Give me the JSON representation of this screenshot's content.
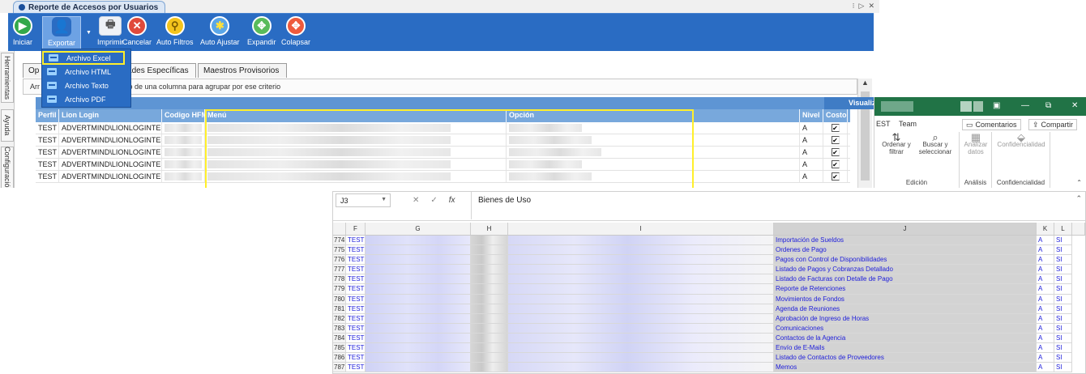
{
  "app": {
    "doc_tab_title": "Reporte de Accesos por Usuarios",
    "window_controls": [
      "⁝",
      "▷",
      "✕"
    ],
    "ribbon": [
      {
        "label": "Iniciar",
        "icon": "play-icon",
        "glyph": "▶"
      },
      {
        "label": "Exportar",
        "icon": "export-user-icon",
        "glyph": "👤"
      },
      {
        "label": "Imprimir",
        "icon": "printer-icon",
        "glyph": "🖶"
      },
      {
        "label": "Cancelar",
        "icon": "cancel-icon",
        "glyph": "✕"
      },
      {
        "label": "Auto Filtros",
        "icon": "filter-icon",
        "glyph": "⚲"
      },
      {
        "label": "Auto Ajustar",
        "icon": "wrench-icon",
        "glyph": "✱"
      },
      {
        "label": "Expandir",
        "icon": "expand-icon",
        "glyph": "✥"
      },
      {
        "label": "Colapsar",
        "icon": "collapse-icon",
        "glyph": "✥"
      }
    ],
    "side_tabs": [
      "Herramientas",
      "Ayuda",
      "Configuración"
    ],
    "export_menu": [
      "Archivo Excel",
      "Archivo HTML",
      "Archivo Texto",
      "Archivo PDF"
    ],
    "content_tabs": [
      "Op",
      "ividades Específicas",
      "Maestros Provisorios"
    ],
    "hint_prefix": "Arr",
    "hint_text": "zado de una columna para agrupar por ese criterio",
    "visual_group_label": "Visualiz",
    "grid_headers": [
      "Perfil",
      "Lion Login",
      "Codigo HFM",
      "Menú",
      "Opción",
      "Nivel",
      "Costo"
    ],
    "grid_rows": [
      {
        "perfil": "TEST",
        "login": "ADVERTMIND\\LIONLOGINTEST",
        "nivel": "A",
        "costo": "✔"
      },
      {
        "perfil": "TEST",
        "login": "ADVERTMIND\\LIONLOGINTEST",
        "nivel": "A",
        "costo": "✔"
      },
      {
        "perfil": "TEST",
        "login": "ADVERTMIND\\LIONLOGINTEST",
        "nivel": "A",
        "costo": "✔"
      },
      {
        "perfil": "TEST",
        "login": "ADVERTMIND\\LIONLOGINTEST",
        "nivel": "A",
        "costo": "✔"
      },
      {
        "perfil": "TEST",
        "login": "ADVERTMIND\\LIONLOGINTEST",
        "nivel": "A",
        "costo": "✔"
      }
    ]
  },
  "excel": {
    "ribbon_tabs": [
      "EST",
      "Team"
    ],
    "comments_button": "Comentarios",
    "share_button": "Compartir",
    "sort_filter": [
      "Ordenar y",
      "filtrar"
    ],
    "find_select": [
      "Buscar y",
      "seleccionar"
    ],
    "analyze_data": [
      "Analizar",
      "datos"
    ],
    "confidentiality": "Confidencialidad",
    "groups": [
      "Edición",
      "Análisis",
      "Confidencialidad"
    ],
    "title_controls": [
      "▣",
      "—",
      "⧉",
      "✕"
    ],
    "name_box": "J3",
    "formula_icons": [
      "✕",
      "✓",
      "fx"
    ],
    "formula_value": "Bienes de Uso",
    "columns": [
      "F",
      "G",
      "H",
      "I",
      "J",
      "K",
      "L"
    ],
    "rows": [
      {
        "n": "774",
        "f": "TEST",
        "j": "Importación de Sueldos",
        "k": "A",
        "l": "SI"
      },
      {
        "n": "775",
        "f": "TEST",
        "j": "Ordenes de Pago",
        "k": "A",
        "l": "SI"
      },
      {
        "n": "776",
        "f": "TEST",
        "j": "Pagos con Control de Disponibilidades",
        "k": "A",
        "l": "SI"
      },
      {
        "n": "777",
        "f": "TEST",
        "j": "Listado de Pagos y Cobranzas Detallado",
        "k": "A",
        "l": "SI"
      },
      {
        "n": "778",
        "f": "TEST",
        "j": "Listado de Facturas con Detalle de Pago",
        "k": "A",
        "l": "SI"
      },
      {
        "n": "779",
        "f": "TEST",
        "j": "Reporte de Retenciones",
        "k": "A",
        "l": "SI"
      },
      {
        "n": "780",
        "f": "TEST",
        "j": "Movimientos de Fondos",
        "k": "A",
        "l": "SI"
      },
      {
        "n": "781",
        "f": "TEST",
        "j": "Agenda de Reuniones",
        "k": "A",
        "l": "SI"
      },
      {
        "n": "782",
        "f": "TEST",
        "j": "Aprobación de Ingreso de Horas",
        "k": "A",
        "l": "SI"
      },
      {
        "n": "783",
        "f": "TEST",
        "j": "Comunicaciones",
        "k": "A",
        "l": "SI"
      },
      {
        "n": "784",
        "f": "TEST",
        "j": "Contactos de la Agencia",
        "k": "A",
        "l": "SI"
      },
      {
        "n": "785",
        "f": "TEST",
        "j": "Envío de E-Mails",
        "k": "A",
        "l": "SI"
      },
      {
        "n": "786",
        "f": "TEST",
        "j": "Listado de Contactos de Proveedores",
        "k": "A",
        "l": "SI"
      },
      {
        "n": "787",
        "f": "TEST",
        "j": "Memos",
        "k": "A",
        "l": "SI"
      }
    ]
  },
  "colors": {
    "ribbon": "#2a6cc3",
    "highlight": "#ffef2b",
    "excel_green": "#217346",
    "grid_header": "#78a8dc"
  }
}
